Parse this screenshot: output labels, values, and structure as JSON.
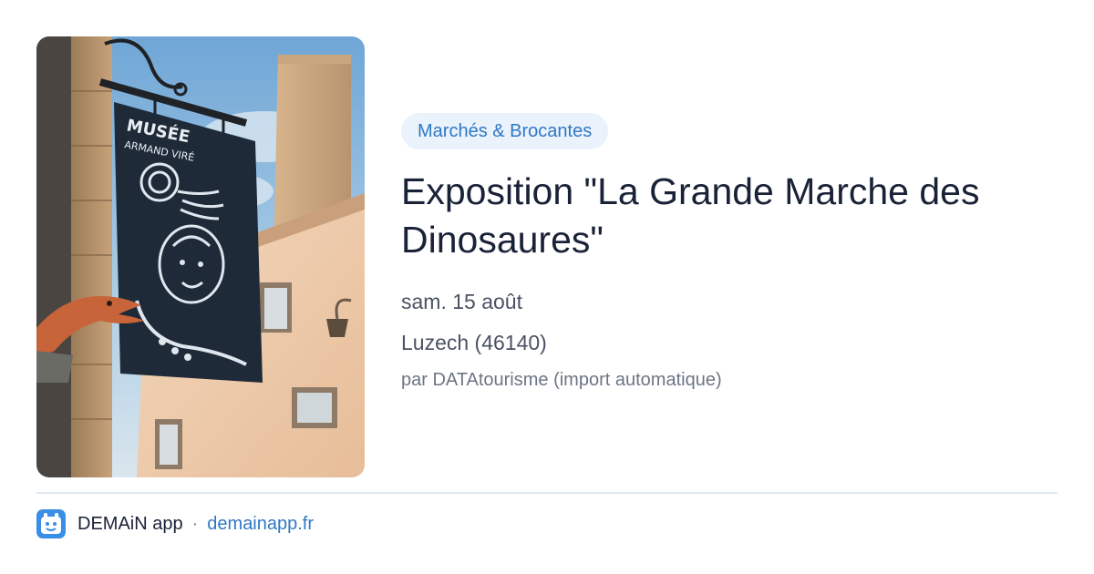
{
  "event": {
    "category": "Marchés & Brocantes",
    "title": "Exposition \"La Grande Marche des Dinosaures\"",
    "date": "sam. 15 août",
    "location": "Luzech (46140)",
    "source": "par DATAtourisme (import automatique)"
  },
  "image": {
    "sign_line1": "MUSÉE",
    "sign_line2": "ARMAND VIRÉ"
  },
  "footer": {
    "app_name": "DEMAiN app",
    "separator": "·",
    "link": "demainapp.fr"
  },
  "colors": {
    "accent": "#2f78c4",
    "category_bg": "#eaf2fb",
    "app_icon": "#3a8ee6"
  }
}
